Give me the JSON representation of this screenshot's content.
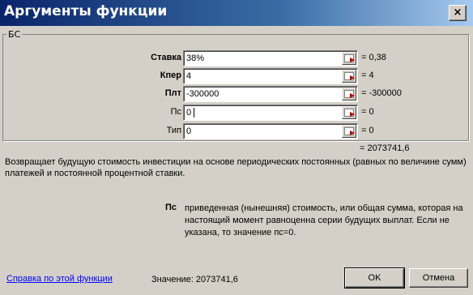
{
  "window": {
    "title": "Аргументы функции",
    "close_symbol": "×"
  },
  "group": {
    "legend": "БС"
  },
  "args": [
    {
      "label": "Ставка",
      "value": "38%",
      "result": "= 0,38",
      "bold": true
    },
    {
      "label": "Кпер",
      "value": "4",
      "result": "= 4",
      "bold": true
    },
    {
      "label": "Плт",
      "value": "-300000",
      "result": "= -300000",
      "bold": true
    },
    {
      "label": "Пс",
      "value": "0",
      "result": "= 0",
      "bold": false
    },
    {
      "label": "Тип",
      "value": "0",
      "result": "= 0",
      "bold": false
    }
  ],
  "total_result": "= 2073741,6",
  "description": "Возвращает будущую стоимость инвестиции на основе периодических постоянных (равных по величине сумм) платежей и постоянной процентной ставки.",
  "param": {
    "name": "Пс",
    "description": "приведенная (нынешняя) стоимость, или общая сумма, которая на настоящий момент равноценна серии будущих выплат. Если не указана, то значение пс=0."
  },
  "footer": {
    "help_link": "Справка по этой функции",
    "value_label": "Значение:",
    "value": "2073741,6",
    "ok_label": "OK",
    "cancel_label": "Отмена"
  },
  "icons": {
    "close": "close-icon",
    "range_select": "range-select-icon"
  },
  "colors": {
    "title_start": "#0a246a",
    "title_end": "#a6caf0",
    "face": "#d4d0c8",
    "link": "#0000ff"
  }
}
